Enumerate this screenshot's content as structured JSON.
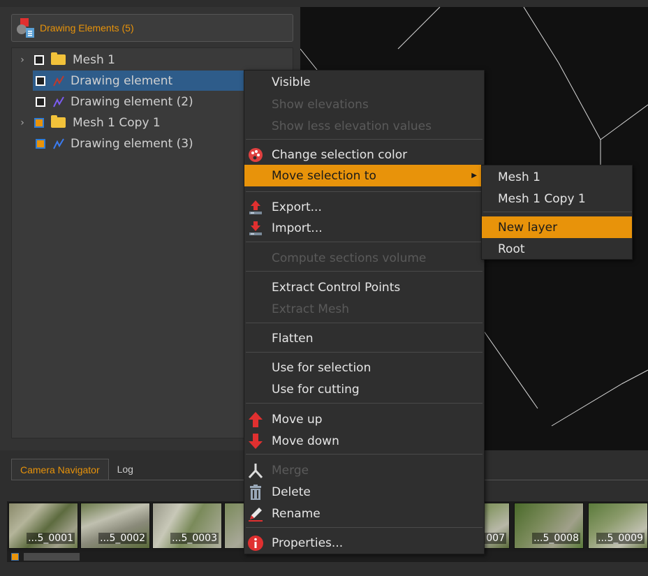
{
  "panel": {
    "title": "Drawing Elements (5)",
    "tree": [
      {
        "label": "Mesh 1",
        "kind": "folder",
        "expandable": true,
        "selected": false
      },
      {
        "label": "Drawing element",
        "kind": "drawing",
        "selected": true
      },
      {
        "label": "Drawing element (2)",
        "kind": "drawing",
        "selected": false
      },
      {
        "label": "Mesh 1 Copy 1",
        "kind": "folder",
        "expandable": true,
        "selected": false
      },
      {
        "label": "Drawing element (3)",
        "kind": "drawing",
        "selected": false
      }
    ]
  },
  "context_menu": {
    "items": [
      {
        "label": "Visible",
        "enabled": true
      },
      {
        "label": "Show elevations",
        "enabled": false
      },
      {
        "label": "Show less elevation values",
        "enabled": false
      },
      {
        "label": "Change selection color",
        "enabled": true,
        "icon": "palette-icon"
      },
      {
        "label": "Move selection to",
        "enabled": true,
        "submenu": true,
        "highlighted": true
      },
      {
        "label": "Export...",
        "enabled": true,
        "icon": "export-icon"
      },
      {
        "label": "Import...",
        "enabled": true,
        "icon": "import-icon"
      },
      {
        "label": "Compute sections volume",
        "enabled": false
      },
      {
        "label": "Extract Control Points",
        "enabled": true
      },
      {
        "label": "Extract Mesh",
        "enabled": false
      },
      {
        "label": "Flatten",
        "enabled": true
      },
      {
        "label": "Use for selection",
        "enabled": true
      },
      {
        "label": "Use for cutting",
        "enabled": true
      },
      {
        "label": "Move up",
        "enabled": true,
        "icon": "arrow-up-icon"
      },
      {
        "label": "Move down",
        "enabled": true,
        "icon": "arrow-down-icon"
      },
      {
        "label": "Merge",
        "enabled": false,
        "icon": "merge-icon"
      },
      {
        "label": "Delete",
        "enabled": true,
        "icon": "trash-icon"
      },
      {
        "label": "Rename",
        "enabled": true,
        "icon": "pencil-icon"
      },
      {
        "label": "Properties...",
        "enabled": true,
        "icon": "info-icon"
      }
    ]
  },
  "submenu": {
    "items": [
      {
        "label": "Mesh 1",
        "highlighted": false
      },
      {
        "label": "Mesh 1 Copy 1",
        "highlighted": false
      },
      {
        "label": "New layer",
        "highlighted": true
      },
      {
        "label": "Root",
        "highlighted": false
      }
    ]
  },
  "bottom": {
    "tabs": [
      {
        "label": "Camera Navigator",
        "active": true
      },
      {
        "label": "Log",
        "active": false
      }
    ],
    "thumbnails": [
      "...5_0001",
      "...5_0002",
      "...5_0003",
      "",
      "",
      "",
      "007",
      "...5_0008",
      "...5_0009"
    ]
  },
  "colors": {
    "accent": "#e8930a",
    "selection": "#2e5c8a",
    "menu_bg": "#2f2f2f"
  }
}
